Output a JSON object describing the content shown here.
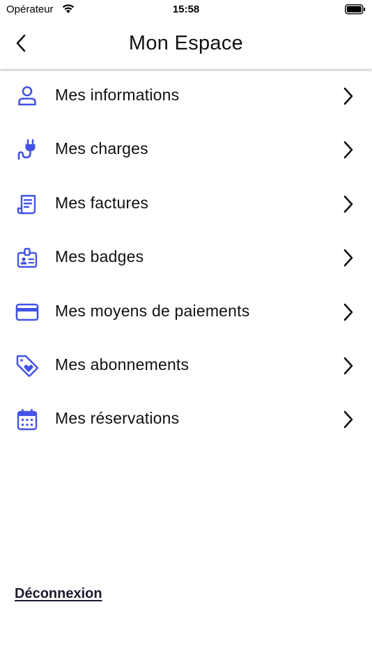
{
  "status_bar": {
    "carrier": "Opérateur",
    "time": "15:58"
  },
  "nav": {
    "title": "Mon Espace"
  },
  "menu": {
    "items": [
      {
        "label": "Mes informations",
        "icon": "user-icon"
      },
      {
        "label": "Mes charges",
        "icon": "plug-icon"
      },
      {
        "label": "Mes factures",
        "icon": "receipt-icon"
      },
      {
        "label": "Mes badges",
        "icon": "badge-icon"
      },
      {
        "label": "Mes moyens de paiements",
        "icon": "credit-card-icon"
      },
      {
        "label": "Mes abonnements",
        "icon": "tag-heart-icon"
      },
      {
        "label": "Mes réservations",
        "icon": "calendar-icon"
      }
    ]
  },
  "footer": {
    "logout_label": "Déconnexion"
  },
  "colors": {
    "accent": "#4353e6",
    "text": "#111111"
  }
}
